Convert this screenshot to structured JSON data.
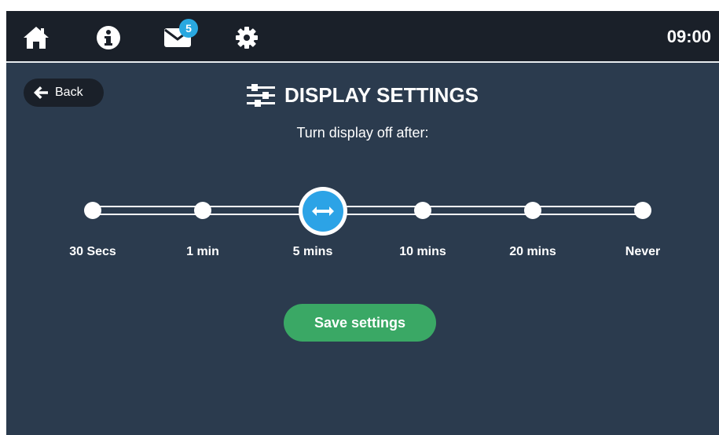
{
  "colors": {
    "background": "#2b3b4e",
    "topbar": "#1a2029",
    "accent_blue": "#2ca3e6",
    "save_green": "#3aa865",
    "text": "#ffffff"
  },
  "topbar": {
    "icons": [
      "home-icon",
      "info-icon",
      "mail-icon",
      "gear-icon"
    ],
    "mail_badge": "5",
    "time": "09:00"
  },
  "back_label": "Back",
  "page": {
    "title": "DISPLAY SETTINGS",
    "title_icon": "sliders-icon",
    "subtitle": "Turn display off after:"
  },
  "slider": {
    "stops": [
      "30 Secs",
      "1 min",
      "5 mins",
      "10 mins",
      "20 mins",
      "Never"
    ],
    "selected_index": 2,
    "thumb_icon": "left-right-arrow-icon"
  },
  "save_label": "Save settings"
}
